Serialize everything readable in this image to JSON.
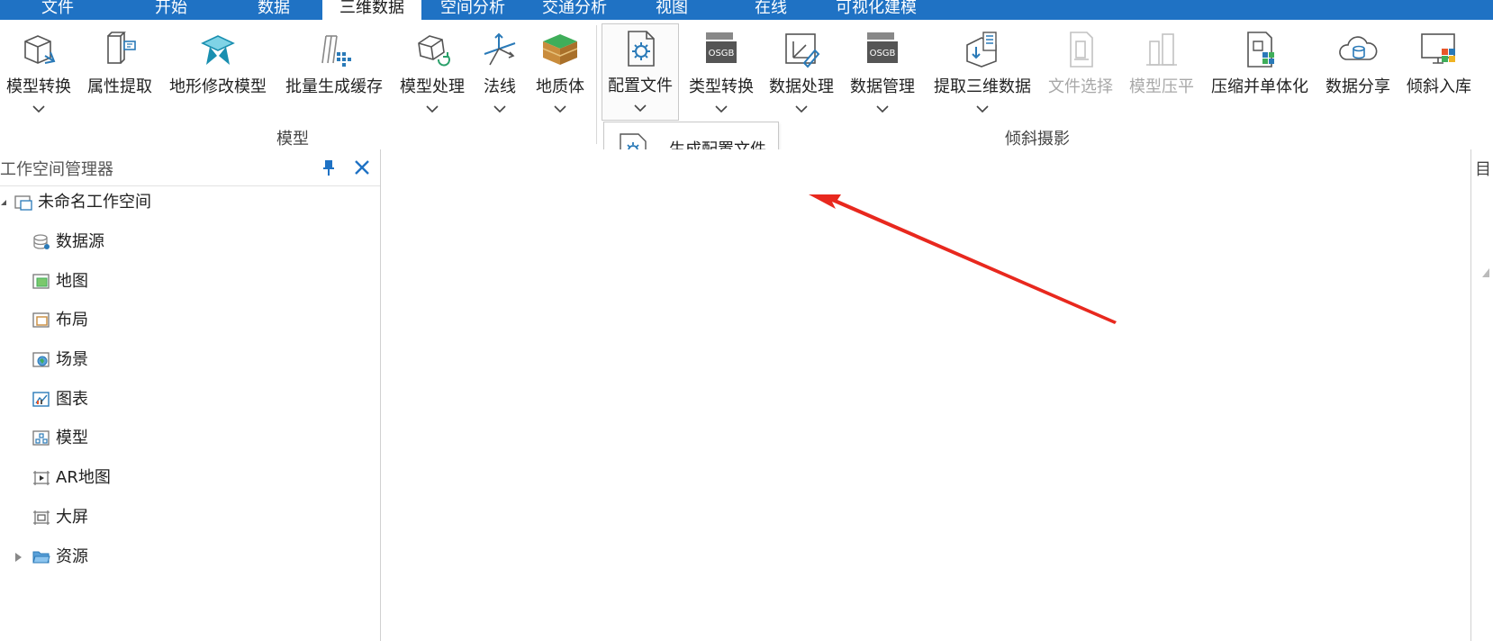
{
  "menu": {
    "tabs": [
      {
        "label": "文件"
      },
      {
        "label": "开始"
      },
      {
        "label": "数据"
      },
      {
        "label": "三维数据"
      },
      {
        "label": "空间分析"
      },
      {
        "label": "交通分析"
      },
      {
        "label": "视图"
      },
      {
        "label": "在线"
      },
      {
        "label": "可视化建模"
      }
    ],
    "active_tab": "三维数据"
  },
  "ribbon": {
    "model_group": {
      "label": "模型",
      "buttons": [
        {
          "label": "模型转换",
          "icon": "model-convert-icon",
          "dropdown": true
        },
        {
          "label": "属性提取",
          "icon": "attribute-extract-icon",
          "dropdown": false
        },
        {
          "label": "地形修改模型",
          "icon": "terrain-modify-icon",
          "dropdown": false
        },
        {
          "label": "批量生成缓存",
          "icon": "batch-cache-icon",
          "dropdown": false
        },
        {
          "label": "模型处理",
          "icon": "model-process-icon",
          "dropdown": true
        },
        {
          "label": "法线",
          "icon": "normal-icon",
          "dropdown": true
        },
        {
          "label": "地质体",
          "icon": "geology-icon",
          "dropdown": true
        }
      ]
    },
    "oblique_group": {
      "label": "倾斜摄影",
      "buttons": [
        {
          "label": "配置文件",
          "icon": "config-file-icon",
          "dropdown": true,
          "pressed": true
        },
        {
          "label": "类型转换",
          "icon": "osgb-type-convert-icon",
          "dropdown": true
        },
        {
          "label": "数据处理",
          "icon": "data-process-icon",
          "dropdown": true
        },
        {
          "label": "数据管理",
          "icon": "osgb-data-manage-icon",
          "dropdown": true
        },
        {
          "label": "提取三维数据",
          "icon": "extract-3d-icon",
          "dropdown": true
        },
        {
          "label": "文件选择",
          "icon": "file-select-icon",
          "dropdown": false,
          "disabled": true
        },
        {
          "label": "模型压平",
          "icon": "model-flatten-icon",
          "dropdown": false,
          "disabled": true
        },
        {
          "label": "压缩并单体化",
          "icon": "compress-monomer-icon",
          "dropdown": false
        },
        {
          "label": "数据分享",
          "icon": "cloud-share-icon",
          "dropdown": false
        },
        {
          "label": "倾斜入库",
          "icon": "oblique-import-icon",
          "dropdown": false
        }
      ]
    },
    "osgb_badge": "OSGB"
  },
  "dropdown": {
    "items": [
      {
        "label": "生成配置文件",
        "icon": "gear-file-icon"
      }
    ]
  },
  "workspace": {
    "title": "工作空间管理器",
    "root": "未命名工作空间",
    "items": [
      {
        "label": "数据源",
        "icon": "datasource-icon"
      },
      {
        "label": "地图",
        "icon": "map-icon"
      },
      {
        "label": "布局",
        "icon": "layout-icon"
      },
      {
        "label": "场景",
        "icon": "scene-icon"
      },
      {
        "label": "图表",
        "icon": "chart-icon"
      },
      {
        "label": "模型",
        "icon": "model-icon"
      },
      {
        "label": "AR地图",
        "icon": "ar-map-icon"
      },
      {
        "label": "大屏",
        "icon": "big-screen-icon"
      },
      {
        "label": "资源",
        "icon": "folder-icon"
      }
    ]
  },
  "right_panel": {
    "tab_label": "目"
  },
  "colors": {
    "menu_bar": "#1f72c4",
    "icon_blue": "#2a7ab8",
    "close_blue": "#1f72c4",
    "annotation_arrow": "#e8281e"
  }
}
